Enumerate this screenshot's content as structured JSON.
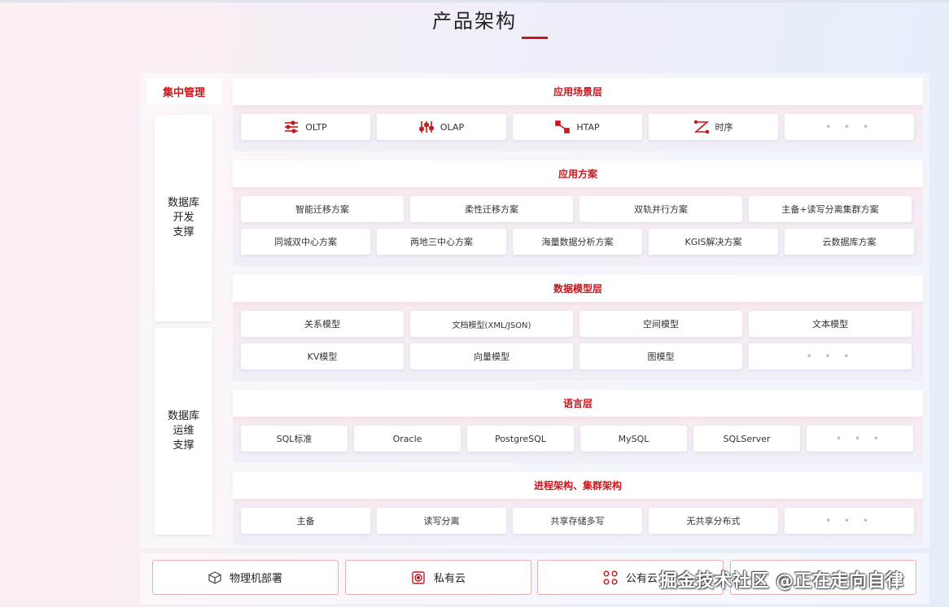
{
  "title": "产品架构",
  "left": {
    "head": "集中管理",
    "dev": [
      "数据库",
      "开发",
      "支撑"
    ],
    "ops": [
      "数据库",
      "运维",
      "支撑"
    ]
  },
  "scenario": {
    "title": "应用场景层",
    "items": [
      {
        "label": "OLTP",
        "icon": "sliders-icon"
      },
      {
        "label": "OLAP",
        "icon": "equalizer-icon"
      },
      {
        "label": "HTAP",
        "icon": "link-nodes-icon"
      },
      {
        "label": "时序",
        "icon": "timeseries-icon"
      },
      {
        "label": "• • •"
      }
    ]
  },
  "solution": {
    "title": "应用方案",
    "row1": [
      "智能迁移方案",
      "柔性迁移方案",
      "双轨并行方案",
      "主备+读写分离集群方案"
    ],
    "row2": [
      "同城双中心方案",
      "两地三中心方案",
      "海量数据分析方案",
      "KGIS解决方案",
      "云数据库方案"
    ]
  },
  "model": {
    "title": "数据模型层",
    "row1": [
      "关系模型",
      "文档模型(XML/JSON)",
      "空间模型",
      "文本模型"
    ],
    "row2": [
      "KV模型",
      "向量模型",
      "图模型",
      "• • •"
    ]
  },
  "language": {
    "title": "语言层",
    "items": [
      "SQL标准",
      "Oracle",
      "PostgreSQL",
      "MySQL",
      "SQLServer",
      "• • •"
    ]
  },
  "arch": {
    "title": "进程架构、集群架构",
    "items": [
      "主备",
      "读写分离",
      "共享存储多写",
      "无共享分布式",
      "• • •"
    ]
  },
  "deploy": [
    {
      "label": "物理机部署",
      "icon": "cube-icon"
    },
    {
      "label": "私有云",
      "icon": "target-icon"
    },
    {
      "label": "公有云",
      "icon": "cluster-icon"
    }
  ],
  "watermark": "掘金技术社区 @正在走向自律",
  "colors": {
    "accent": "#c8161d",
    "border": "#e9aeb2"
  }
}
